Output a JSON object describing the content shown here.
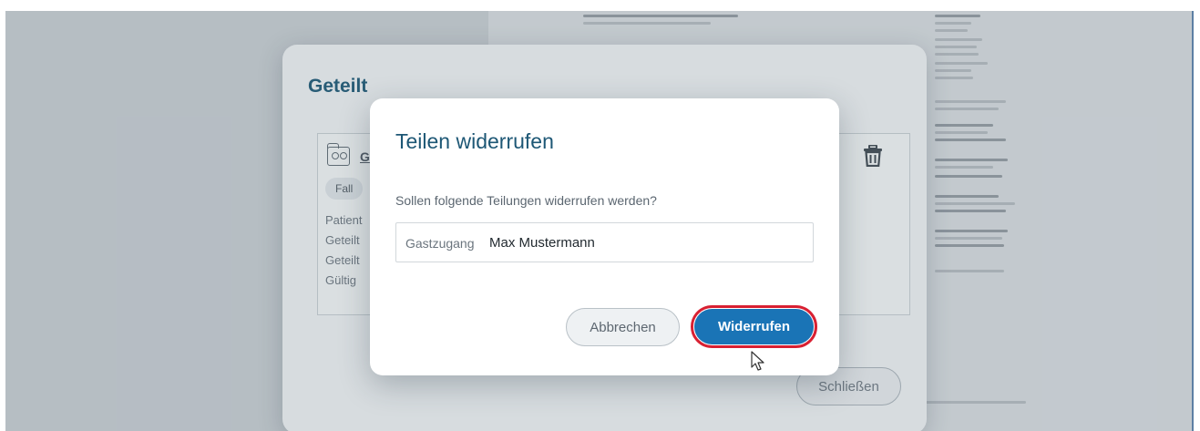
{
  "outer_dialog": {
    "title": "Geteilt",
    "card": {
      "title": "G",
      "badge": "Fall",
      "lines": [
        "Patient",
        "Geteilt",
        "Geteilt",
        "Gültig"
      ]
    },
    "close_label": "Schließen"
  },
  "modal": {
    "title": "Teilen widerrufen",
    "question": "Sollen folgende Teilungen widerrufen werden?",
    "share": {
      "type": "Gastzugang",
      "name": "Max Mustermann"
    },
    "cancel_label": "Abbrechen",
    "revoke_label": "Widerrufen"
  },
  "colors": {
    "accent": "#1a74b6",
    "title": "#1d5775",
    "highlight_ring": "#d82032"
  },
  "icons": [
    "shared-folder-icon",
    "trash-icon",
    "mouse-cursor-icon"
  ]
}
